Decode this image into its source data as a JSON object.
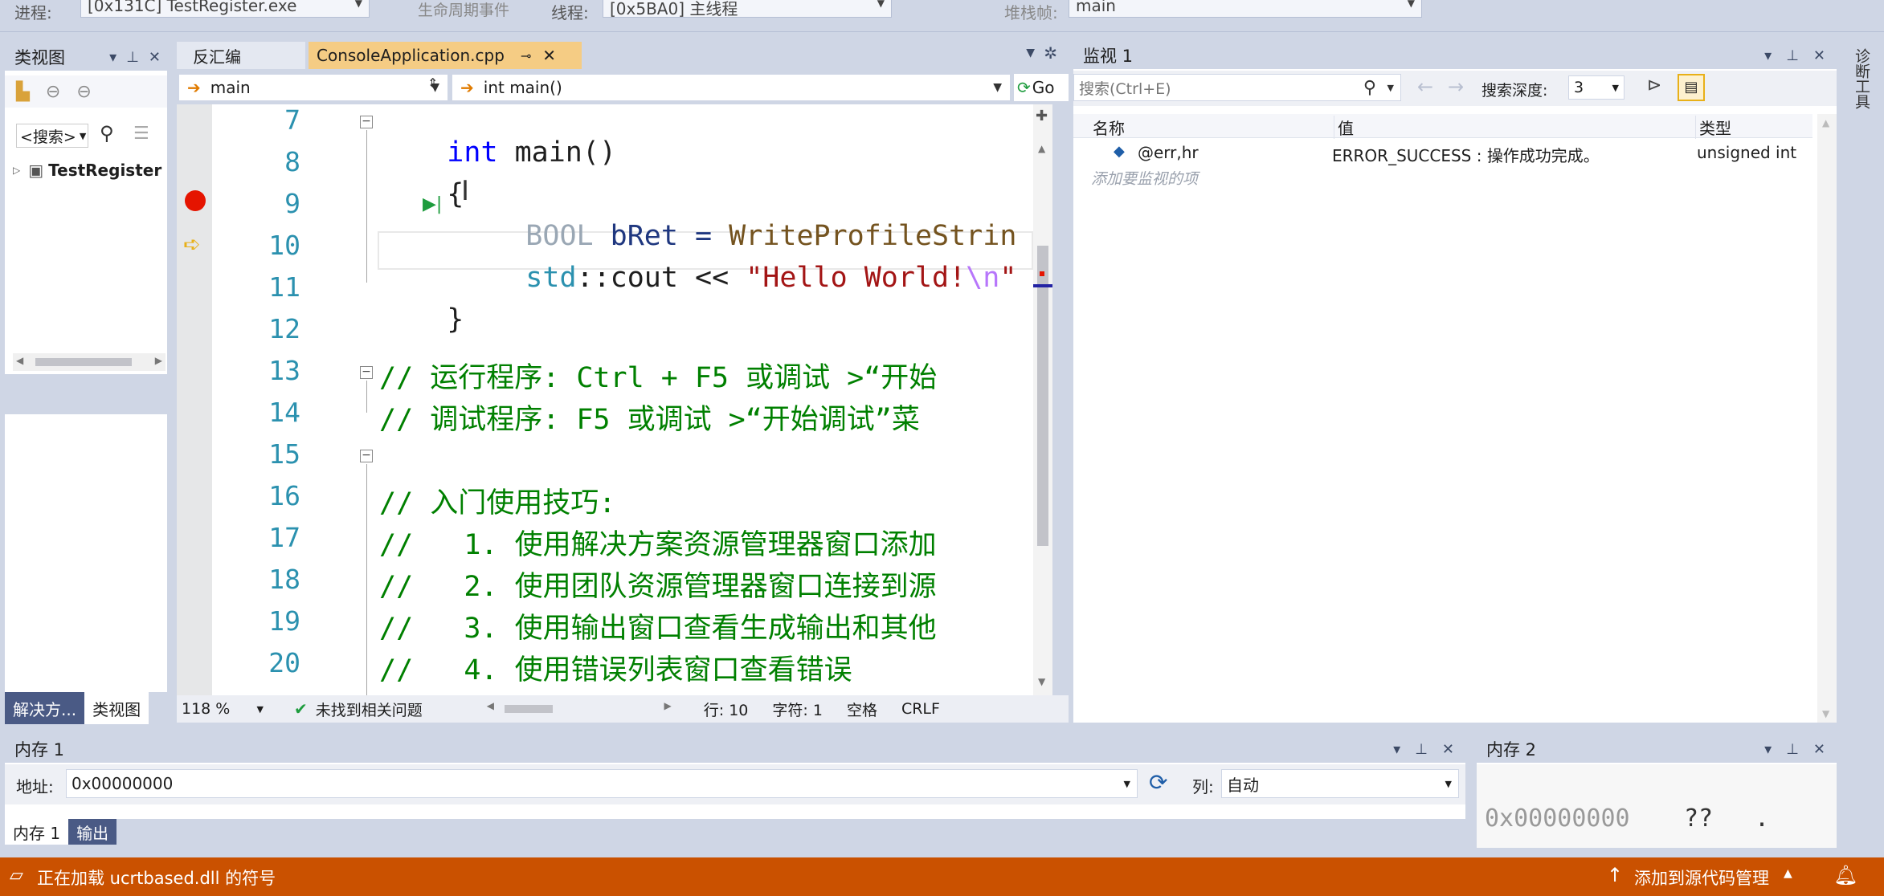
{
  "toolbar": {
    "process_label": "进程:",
    "process_value": "[0x131C] TestRegister.exe",
    "lifecycle_label": "生命周期事件",
    "thread_label": "线程:",
    "thread_value": "[0x5BA0] 主线程",
    "stackframe_label": "堆栈帧:",
    "stackframe_value": "main"
  },
  "classview": {
    "title": "类视图",
    "search_label": "<搜索>",
    "tree_item": "TestRegister",
    "bottom_tabs": [
      "解决方...",
      "类视图"
    ]
  },
  "editor": {
    "tabs": [
      {
        "label": "反汇编",
        "active": false
      },
      {
        "label": "ConsoleApplication.cpp",
        "active": true
      }
    ],
    "scope_dropdown": "main",
    "function_dropdown": "int main()",
    "go_button": "Go",
    "line_numbers": [
      "7",
      "8",
      "9",
      "10",
      "11",
      "12",
      "13",
      "14",
      "15",
      "16",
      "17",
      "18",
      "19",
      "20"
    ],
    "lines": {
      "l7_kw": "int",
      "l7_rest": " main()",
      "l8": "{",
      "l9_type": "BOOL",
      "l9_rest": " bRet = ",
      "l9_fn": "WriteProfileStrin",
      "l10_ns": "std",
      "l10_op": "::cout << ",
      "l10_str": "\"Hello World!",
      "l10_esc": "\\n",
      "l10_end": "\"",
      "l11": "}",
      "l13": "// 运行程序: Ctrl + F5 或调试 >“开始",
      "l14": "// 调试程序: F5 或调试 >“开始调试”菜",
      "l16": "// 入门使用技巧:",
      "l17": "//   1. 使用解决方案资源管理器窗口添加",
      "l18": "//   2. 使用团队资源管理器窗口连接到源",
      "l19": "//   3. 使用输出窗口查看生成输出和其他",
      "l20": "//   4. 使用错误列表窗口查看错误"
    },
    "status": {
      "zoom": "118 %",
      "issues": "未找到相关问题",
      "line": "行: 10",
      "col": "字符: 1",
      "spacing": "空格",
      "eol": "CRLF"
    }
  },
  "watch": {
    "title": "监视 1",
    "search_placeholder": "搜索(Ctrl+E)",
    "depth_label": "搜索深度:",
    "depth_value": "3",
    "columns": [
      "名称",
      "值",
      "类型"
    ],
    "rows": [
      {
        "name": "@err,hr",
        "value": "ERROR_SUCCESS : 操作成功完成。",
        "type": "unsigned int"
      }
    ],
    "add_hint": "添加要监视的项"
  },
  "memory1": {
    "title": "内存 1",
    "address_label": "地址:",
    "address_value": "0x00000000",
    "columns_label": "列:",
    "columns_value": "自动",
    "tabs": [
      "内存 1",
      "输出"
    ]
  },
  "memory2": {
    "title": "内存 2",
    "address": "0x00000000",
    "bytes": "??",
    "ascii": "."
  },
  "right_strip": {
    "label": "诊断工具"
  },
  "statusbar": {
    "message": "正在加载 ucrtbased.dll 的符号",
    "source_control": "添加到源代码管理",
    "bg_color": "#ca5100"
  }
}
